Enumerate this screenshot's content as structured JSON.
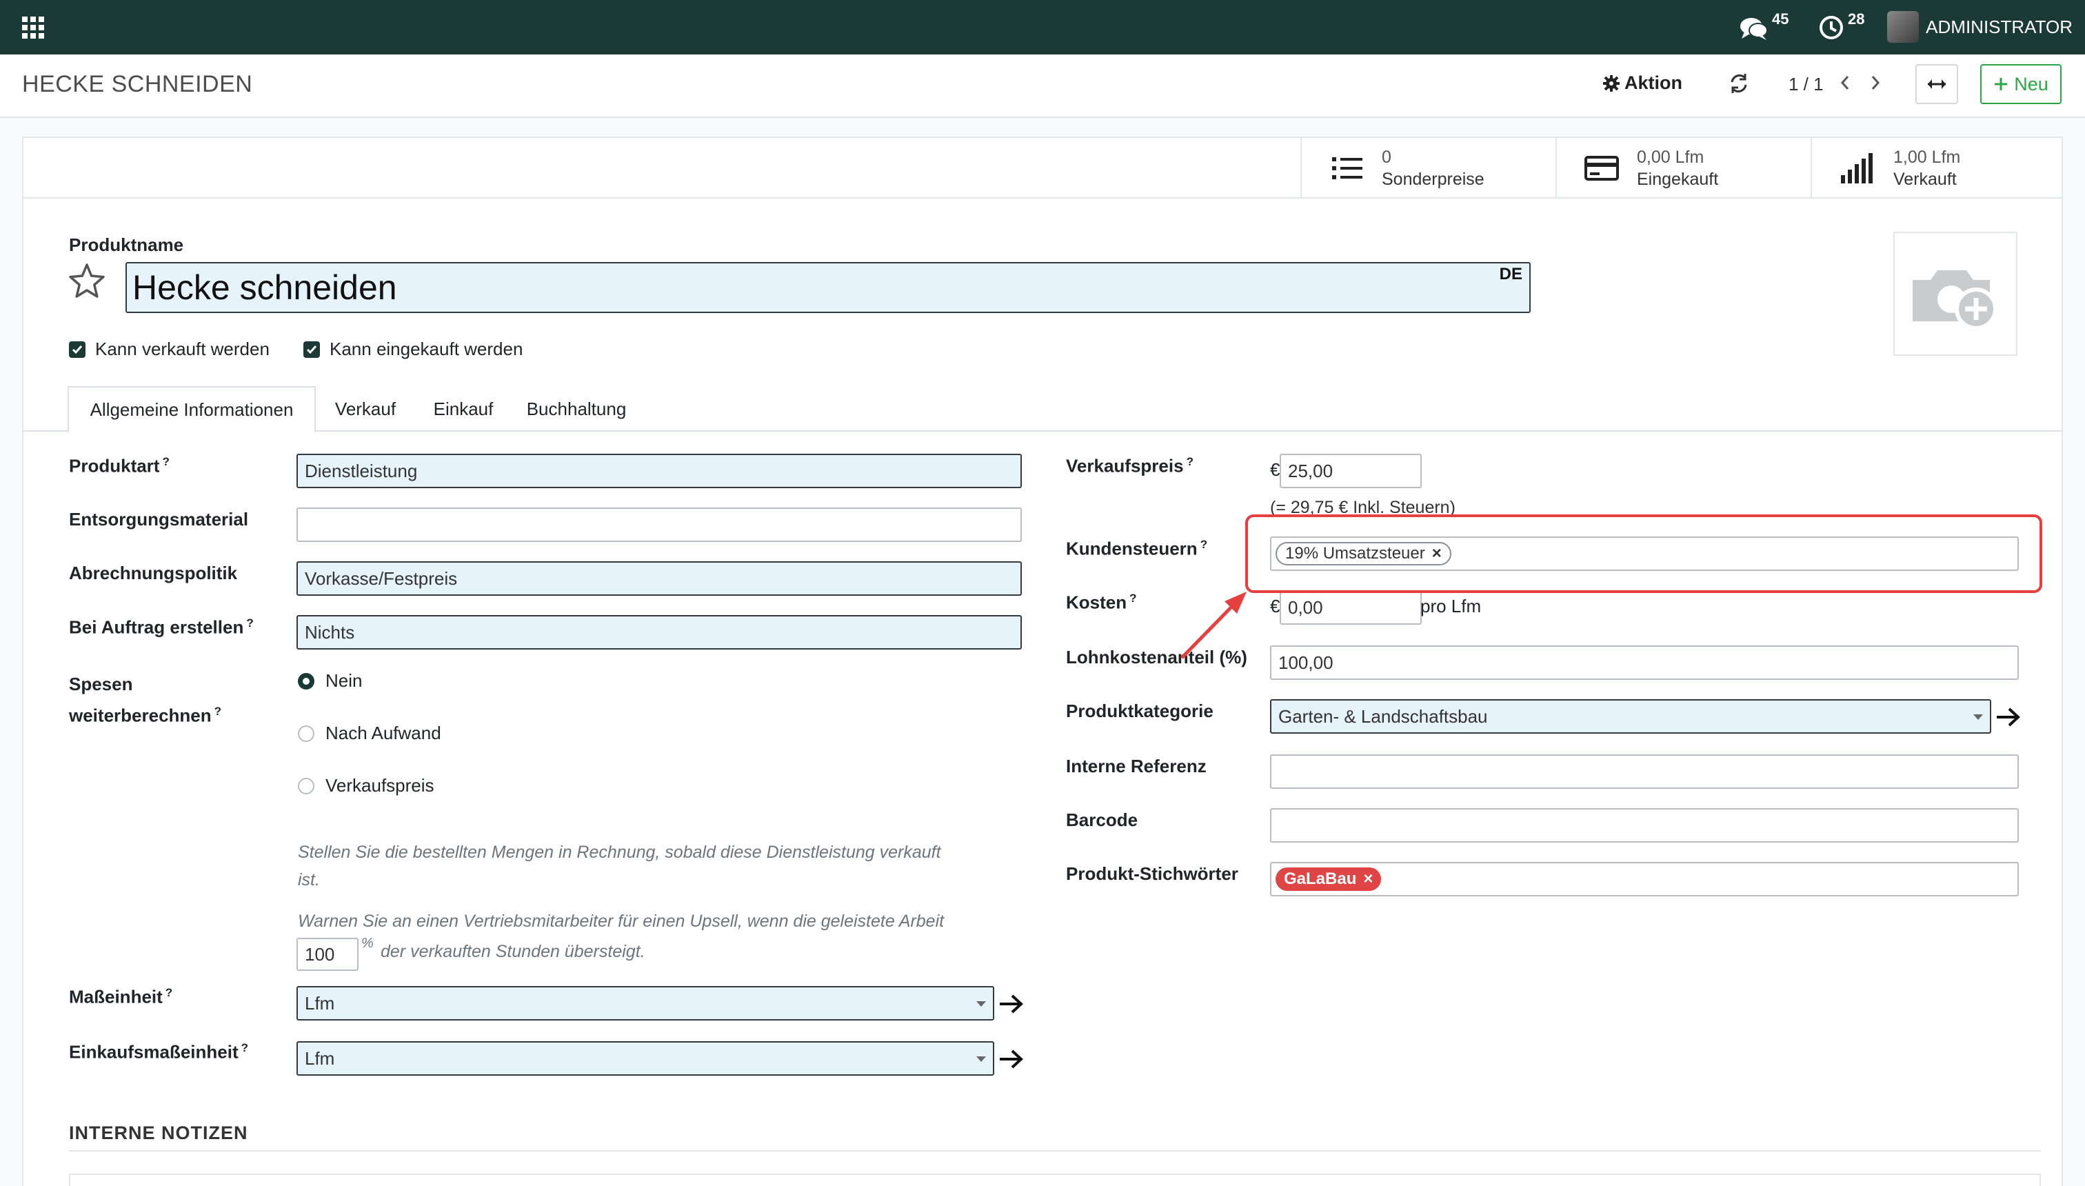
{
  "navbar": {
    "messages_count": "45",
    "activities_count": "28",
    "user_name": "ADMINISTRATOR"
  },
  "control_panel": {
    "breadcrumb": "HECKE SCHNEIDEN",
    "action_label": "Aktion",
    "pager": "1 / 1",
    "new_label": "Neu"
  },
  "stats": [
    {
      "value": "0",
      "label": "Sonderpreise",
      "icon": "list-icon"
    },
    {
      "value": "0,00 Lfm",
      "label": "Eingekauft",
      "icon": "credit-card-icon"
    },
    {
      "value": "1,00 Lfm",
      "label": "Verkauft",
      "icon": "signal-bars-icon"
    }
  ],
  "product": {
    "name_label": "Produktname",
    "name": "Hecke schneiden",
    "lang": "DE",
    "can_be_sold": "Kann verkauft werden",
    "can_be_purchased": "Kann eingekauft werden"
  },
  "tabs": [
    "Allgemeine Informationen",
    "Verkauf",
    "Einkauf",
    "Buchhaltung"
  ],
  "left": {
    "produktart_label": "Produktart",
    "produktart": "Dienstleistung",
    "entsorgung_label": "Entsorgungsmaterial",
    "entsorgung": "",
    "abrechnung_label": "Abrechnungspolitik",
    "abrechnung": "Vorkasse/Festpreis",
    "auftrag_label": "Bei Auftrag erstellen",
    "auftrag": "Nichts",
    "spesen_label_1": "Spesen",
    "spesen_label_2": "weiterberechnen",
    "radio_nein": "Nein",
    "radio_aufwand": "Nach Aufwand",
    "radio_verkaufspreis": "Verkaufspreis",
    "hint_1": "Stellen Sie die bestellten Mengen in Rechnung, sobald diese Dienstleistung verkauft",
    "hint_1b": "ist.",
    "hint_2": "Warnen Sie an einen Vertriebsmitarbeiter für einen Upsell, wenn die geleistete Arbeit",
    "upsell_value": "100",
    "upsell_pct": "%",
    "hint_2b": "der verkauften Stunden übersteigt.",
    "uom_label": "Maßeinheit",
    "uom": "Lfm",
    "purchase_uom_label": "Einkaufsmaßeinheit",
    "purchase_uom": "Lfm"
  },
  "right": {
    "verkaufspreis_label": "Verkaufspreis",
    "currency": "€",
    "verkaufspreis": "25,00",
    "incl_tax": "(= 29,75 € Inkl. Steuern)",
    "kundensteuern_label": "Kundensteuern",
    "tax_tag": "19% Umsatzsteuer",
    "kosten_label": "Kosten",
    "kosten": "0,00",
    "per_unit": "pro Lfm",
    "lohn_label": "Lohnkostenanteil (%)",
    "lohn": "100,00",
    "kategorie_label": "Produktkategorie",
    "kategorie": "Garten- & Landschaftsbau",
    "referenz_label": "Interne Referenz",
    "referenz": "",
    "barcode_label": "Barcode",
    "barcode": "",
    "stichwoerter_label": "Produkt-Stichwörter",
    "stichwort_tag": "GaLaBau"
  },
  "notes_title": "INTERNE NOTIZEN",
  "colors": {
    "navbar": "#1b3a36",
    "required_field": "#e6f3fb",
    "new_button": "#28a745",
    "annotation": "#e5403f",
    "tag_red": "#e04545"
  }
}
